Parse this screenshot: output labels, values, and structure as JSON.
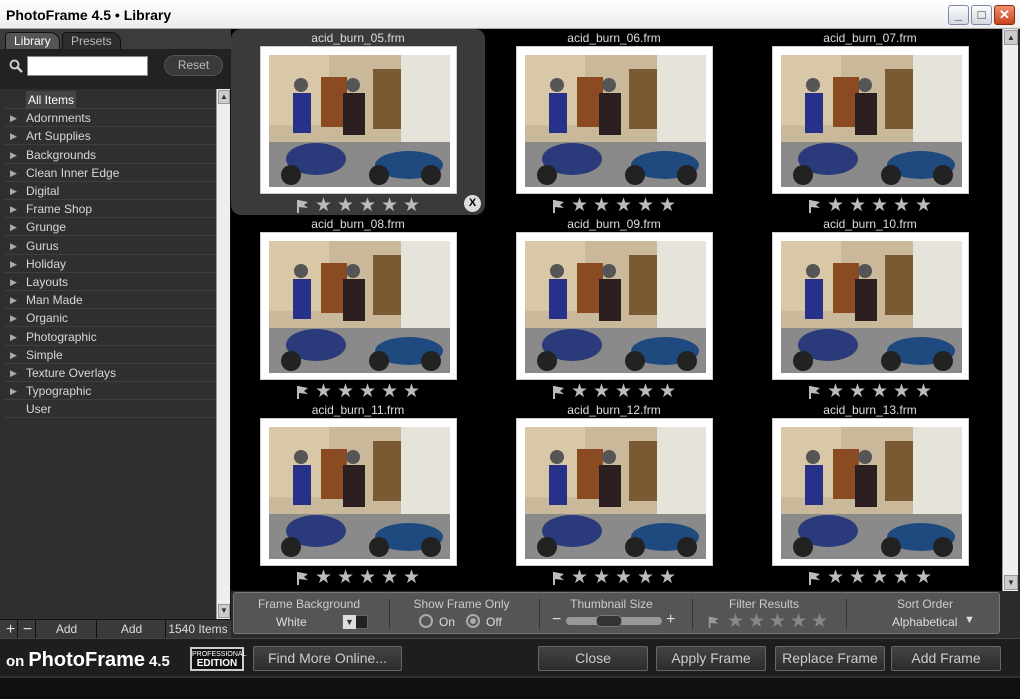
{
  "window": {
    "title": "PhotoFrame 4.5 • Library"
  },
  "left_panel": {
    "tabs": [
      {
        "label": "Library"
      },
      {
        "label": "Presets"
      }
    ],
    "reset_label": "Reset",
    "categories": [
      {
        "label": "All Items"
      },
      {
        "label": "Adornments"
      },
      {
        "label": "Art Supplies"
      },
      {
        "label": "Backgrounds"
      },
      {
        "label": "Clean Inner Edge"
      },
      {
        "label": "Digital"
      },
      {
        "label": "Frame Shop"
      },
      {
        "label": "Grunge"
      },
      {
        "label": "Gurus"
      },
      {
        "label": "Holiday"
      },
      {
        "label": "Layouts"
      },
      {
        "label": "Man Made"
      },
      {
        "label": "Organic"
      },
      {
        "label": "Photographic"
      },
      {
        "label": "Simple"
      },
      {
        "label": "Texture Overlays"
      },
      {
        "label": "Typographic"
      },
      {
        "label": "User"
      }
    ],
    "footer": {
      "add_instant": "Add Instant",
      "add_random": "Add Random",
      "count": "1540 Items"
    }
  },
  "thumbnails": [
    {
      "name": "acid_burn_05.frm"
    },
    {
      "name": "acid_burn_06.frm"
    },
    {
      "name": "acid_burn_07.frm"
    },
    {
      "name": "acid_burn_08.frm"
    },
    {
      "name": "acid_burn_09.frm"
    },
    {
      "name": "acid_burn_10.frm"
    },
    {
      "name": "acid_burn_11.frm"
    },
    {
      "name": "acid_burn_12.frm"
    },
    {
      "name": "acid_burn_13.frm"
    }
  ],
  "controls": {
    "frame_background": {
      "label": "Frame Background",
      "value": "White"
    },
    "show_frame_only": {
      "label": "Show Frame Only",
      "on": "On",
      "off": "Off"
    },
    "thumbnail_size": {
      "label": "Thumbnail Size"
    },
    "filter_results": {
      "label": "Filter Results"
    },
    "sort_order": {
      "label": "Sort Order",
      "value": "Alphabetical"
    }
  },
  "bottom": {
    "brand": "PhotoFrame",
    "brand_version": "4.5",
    "brand_prefix": "on",
    "edition_top": "PROFESSIONAL",
    "edition_bottom": "EDITION",
    "find_more": "Find More Online...",
    "close": "Close",
    "apply": "Apply Frame",
    "replace": "Replace Frame",
    "add": "Add Frame"
  },
  "colors": {
    "background": "#000000",
    "panel": "#333333",
    "star": "#bbbbbb"
  }
}
